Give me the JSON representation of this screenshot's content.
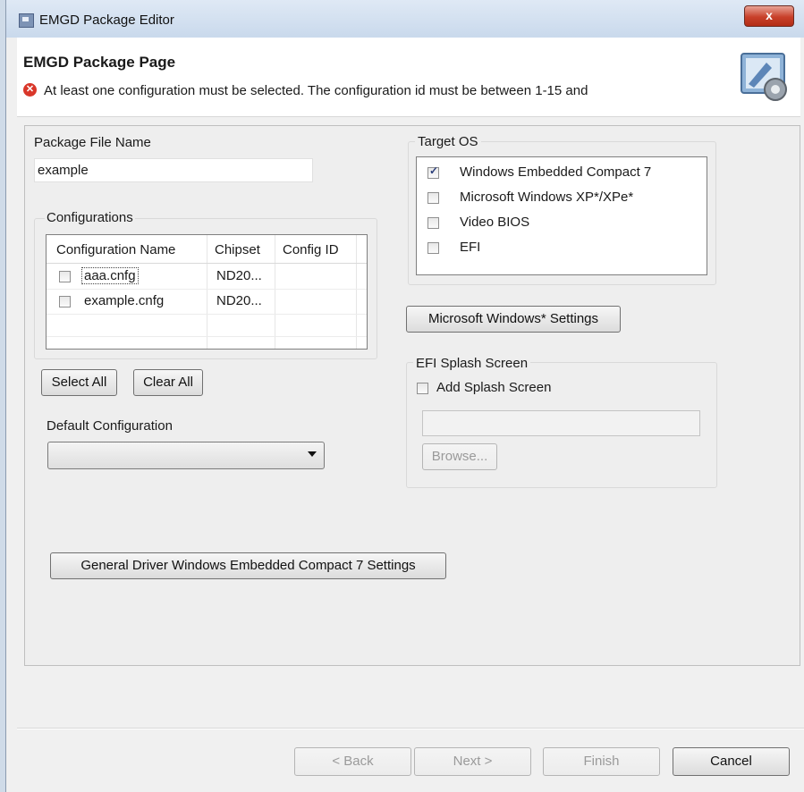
{
  "window": {
    "title": "EMGD Package Editor",
    "close_label": "x"
  },
  "header": {
    "title": "EMGD Package Page",
    "error_message": "At least one configuration must be selected. The configuration id must be between 1-15 and"
  },
  "package": {
    "label": "Package File Name",
    "value": "example"
  },
  "configurations": {
    "group_label": "Configurations",
    "columns": [
      "Configuration Name",
      "Chipset",
      "Config ID"
    ],
    "rows": [
      {
        "name": "aaa.cnfg",
        "chipset": "ND20...",
        "config_id": "",
        "checked": false
      },
      {
        "name": "example.cnfg",
        "chipset": "ND20...",
        "config_id": "",
        "checked": false
      }
    ],
    "select_all": "Select All",
    "clear_all": "Clear All"
  },
  "default_config": {
    "label": "Default Configuration",
    "value": ""
  },
  "target_os": {
    "label": "Target OS",
    "options": [
      {
        "label": "Windows Embedded Compact 7",
        "checked": true
      },
      {
        "label": "Microsoft Windows XP*/XPe*",
        "checked": false
      },
      {
        "label": "Video BIOS",
        "checked": false
      },
      {
        "label": "EFI",
        "checked": false
      }
    ]
  },
  "ms_settings_button": "Microsoft Windows* Settings",
  "efi": {
    "group_label": "EFI Splash Screen",
    "add_label": "Add Splash Screen",
    "path_value": "",
    "browse": "Browse..."
  },
  "general_driver_button": "General Driver Windows Embedded Compact 7 Settings",
  "footer": {
    "back": "< Back",
    "next": "Next >",
    "finish": "Finish",
    "cancel": "Cancel"
  }
}
